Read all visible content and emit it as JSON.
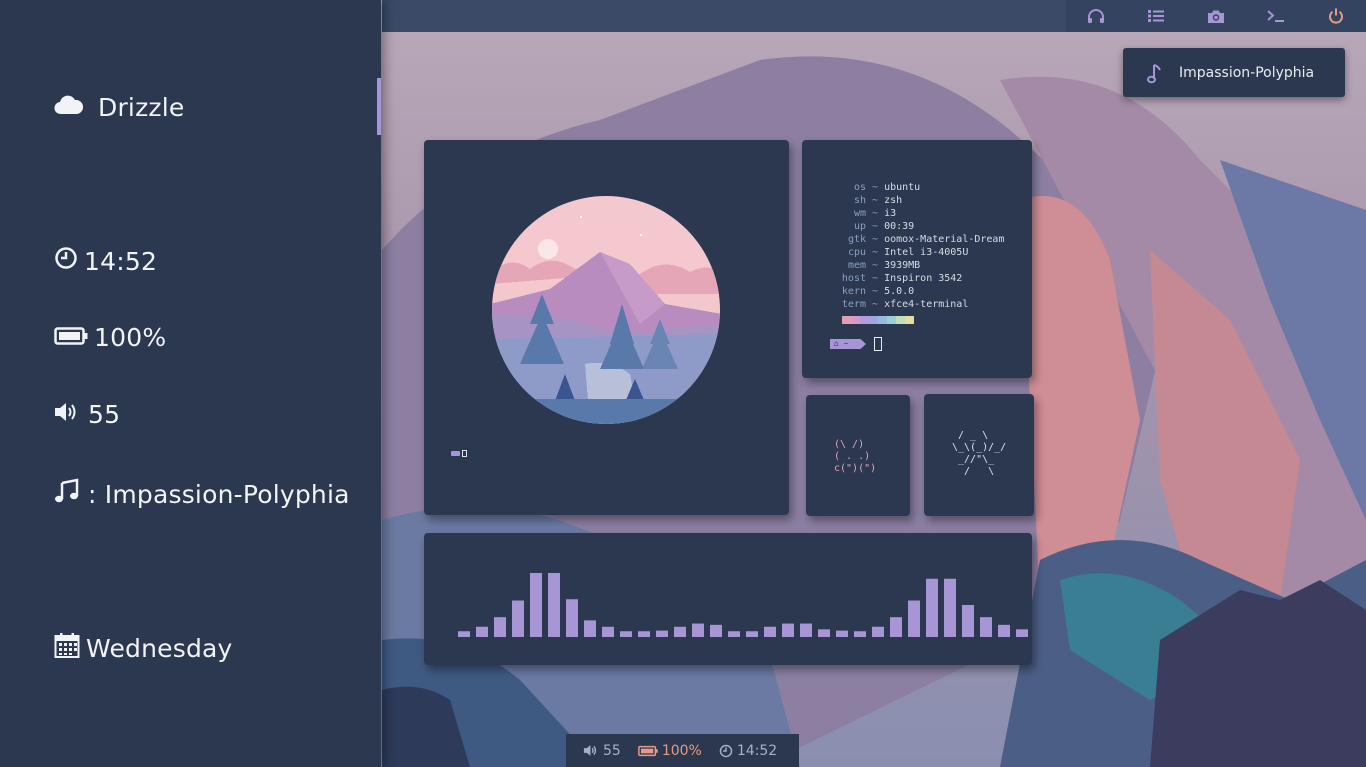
{
  "colors": {
    "accent": "#a795d6",
    "panel": "#2b3850",
    "topbar": "#3a4a67",
    "cat": "#e0a6b7"
  },
  "sidebar": {
    "weather": {
      "icon": "cloud-icon",
      "label": "Drizzle"
    },
    "clock": {
      "icon": "clock-icon",
      "value": "14:52"
    },
    "battery": {
      "icon": "battery-icon",
      "value": "100%"
    },
    "volume": {
      "icon": "volume-icon",
      "value": "55"
    },
    "music": {
      "icon": "music-note-icon",
      "value": ": Impassion-Polyphia"
    },
    "day": {
      "icon": "calendar-icon",
      "value": "Wednesday"
    }
  },
  "topbar": {
    "buttons": [
      {
        "name": "headphones-button",
        "icon": "headphones-icon"
      },
      {
        "name": "list-button",
        "icon": "list-icon"
      },
      {
        "name": "screenshot-button",
        "icon": "camera-icon"
      },
      {
        "name": "terminal-button",
        "icon": "terminal-icon"
      },
      {
        "name": "power-button",
        "icon": "power-icon"
      }
    ]
  },
  "music_popup": {
    "icon": "music-note-icon",
    "title": "Impassion-Polyphia"
  },
  "fetch": {
    "rows": [
      {
        "key": "os",
        "value": "ubuntu"
      },
      {
        "key": "sh",
        "value": "zsh"
      },
      {
        "key": "wm",
        "value": "i3"
      },
      {
        "key": "up",
        "value": "00:39"
      },
      {
        "key": "gtk",
        "value": "oomox-Material-Dream"
      },
      {
        "key": "cpu",
        "value": "Intel i3-4005U"
      },
      {
        "key": "mem",
        "value": "3939MB"
      },
      {
        "key": "host",
        "value": "Inspiron 3542"
      },
      {
        "key": "kern",
        "value": "5.0.0"
      },
      {
        "key": "term",
        "value": "xfce4-terminal"
      }
    ],
    "separator": "~",
    "palette": [
      "#e49bb3",
      "#d99bc5",
      "#b59bd8",
      "#9fa6e0",
      "#97b9dd",
      "#9bd1d2",
      "#bfe0b6",
      "#e6dca0"
    ],
    "prompt": "~"
  },
  "ascii": {
    "cat": "(\\ /)\n( . .)\nc(\")(\")",
    "spider": " / _ \\\n\\_\\(_)/_/\n _//\"\\_\n  /   \\"
  },
  "visualizer": {
    "bars": [
      0.09,
      0.16,
      0.31,
      0.57,
      1.0,
      1.0,
      0.59,
      0.26,
      0.16,
      0.09,
      0.09,
      0.1,
      0.16,
      0.21,
      0.19,
      0.09,
      0.09,
      0.16,
      0.21,
      0.21,
      0.12,
      0.1,
      0.09,
      0.16,
      0.31,
      0.57,
      0.91,
      0.91,
      0.5,
      0.31,
      0.19,
      0.12
    ]
  },
  "bottombar": {
    "volume": "55",
    "battery": "100%",
    "clock": "14:52"
  }
}
